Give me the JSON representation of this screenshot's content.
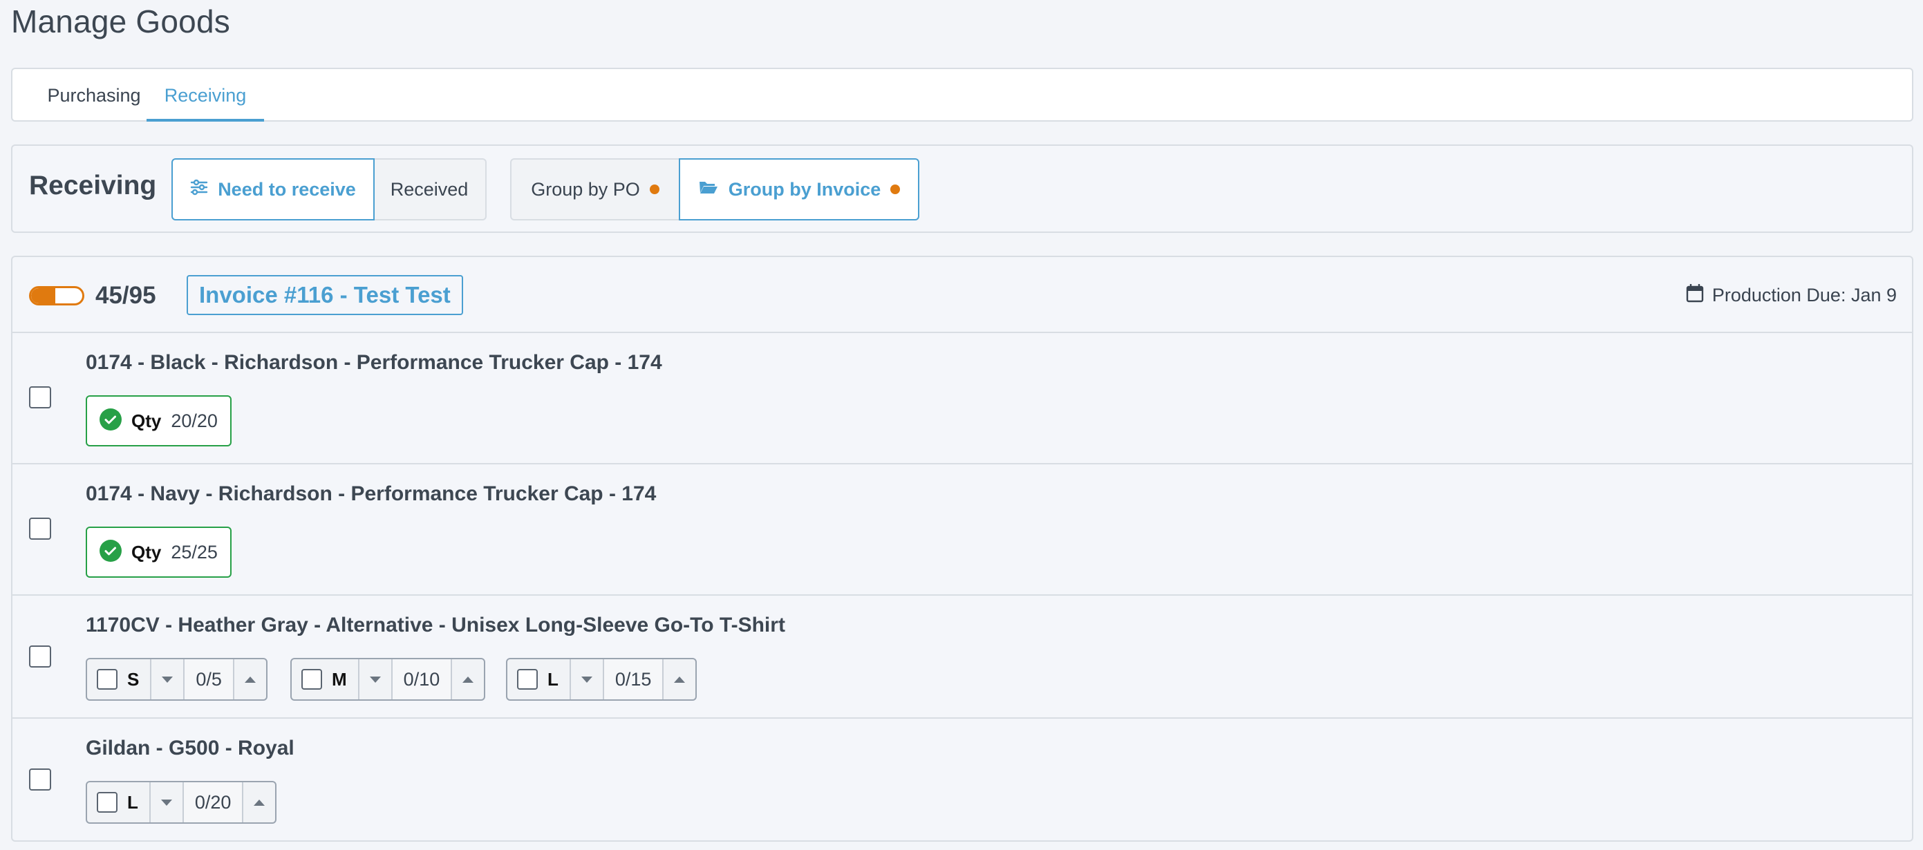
{
  "page": {
    "title": "Manage Goods"
  },
  "tabs": [
    {
      "label": "Purchasing",
      "active": false
    },
    {
      "label": "Receiving",
      "active": true
    }
  ],
  "receiving": {
    "title": "Receiving",
    "filters": [
      {
        "label": "Need to receive",
        "active": true,
        "icon": "sliders-icon"
      },
      {
        "label": "Received",
        "active": false
      }
    ],
    "grouping": [
      {
        "label": "Group by PO",
        "active": false,
        "dot": true
      },
      {
        "label": "Group by Invoice",
        "active": true,
        "dot": true,
        "icon": "folder-open-icon"
      }
    ],
    "dot_color": "#e07a0f",
    "accent_color": "#4a9fd1"
  },
  "invoice": {
    "progress": {
      "received": 45,
      "total": 95,
      "label": "45/95",
      "fraction": 0.47
    },
    "title": "Invoice #116 - Test Test",
    "due_label": "Production Due: Jan 9",
    "items": [
      {
        "title": "0174 - Black - Richardson - Performance Trucker Cap - 174",
        "qty_label": "Qty",
        "qty_value": "20/20",
        "complete": true
      },
      {
        "title": "0174 - Navy - Richardson - Performance Trucker Cap - 174",
        "qty_label": "Qty",
        "qty_value": "25/25",
        "complete": true
      },
      {
        "title": "1170CV - Heather Gray - Alternative - Unisex Long-Sleeve Go-To T-Shirt",
        "sizes": [
          {
            "size": "S",
            "value": "0/5"
          },
          {
            "size": "M",
            "value": "0/10"
          },
          {
            "size": "L",
            "value": "0/15"
          }
        ]
      },
      {
        "title": "Gildan - G500 - Royal",
        "sizes": [
          {
            "size": "L",
            "value": "0/20"
          }
        ]
      }
    ]
  }
}
